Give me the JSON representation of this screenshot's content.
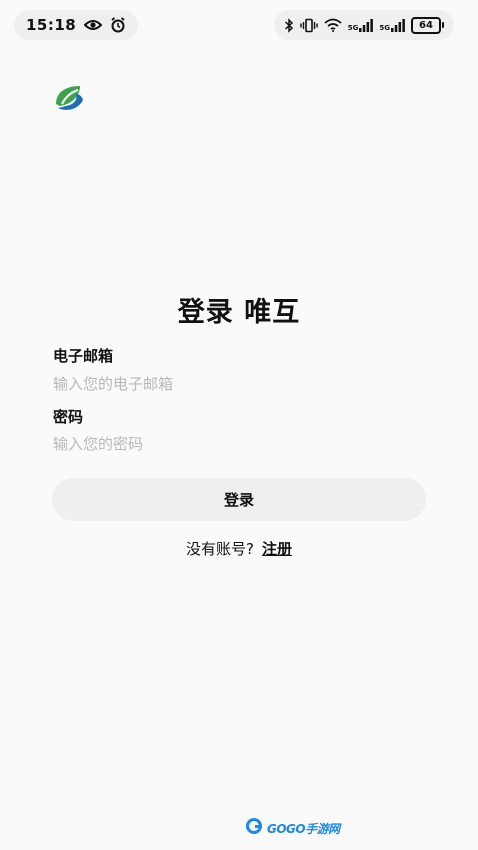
{
  "status_bar": {
    "time": "15:18",
    "battery": "64",
    "network_1": "5G",
    "network_2": "5G"
  },
  "login": {
    "title": "登录 唯互",
    "email_label": "电子邮箱",
    "email_placeholder": "输入您的电子邮箱",
    "password_label": "密码",
    "password_placeholder": "输入您的密码",
    "login_button": "登录",
    "no_account_text": "没有账号?",
    "register_link": "注册"
  },
  "watermark": {
    "text": "GOGO手游网"
  },
  "colors": {
    "background": "#fafafa",
    "button_bg": "#efefef",
    "placeholder": "#b8b8b8",
    "logo_green": "#3fa34d",
    "logo_blue": "#1f6fb2",
    "watermark_blue": "#1e88e5"
  },
  "icons": {
    "status_left": [
      "eye-icon",
      "alarm-icon"
    ],
    "status_right": [
      "bluetooth-icon",
      "vibrate-icon",
      "wifi-icon",
      "signal-icon",
      "signal-icon",
      "battery-icon"
    ],
    "app_logo": "leaf-logo-icon"
  }
}
